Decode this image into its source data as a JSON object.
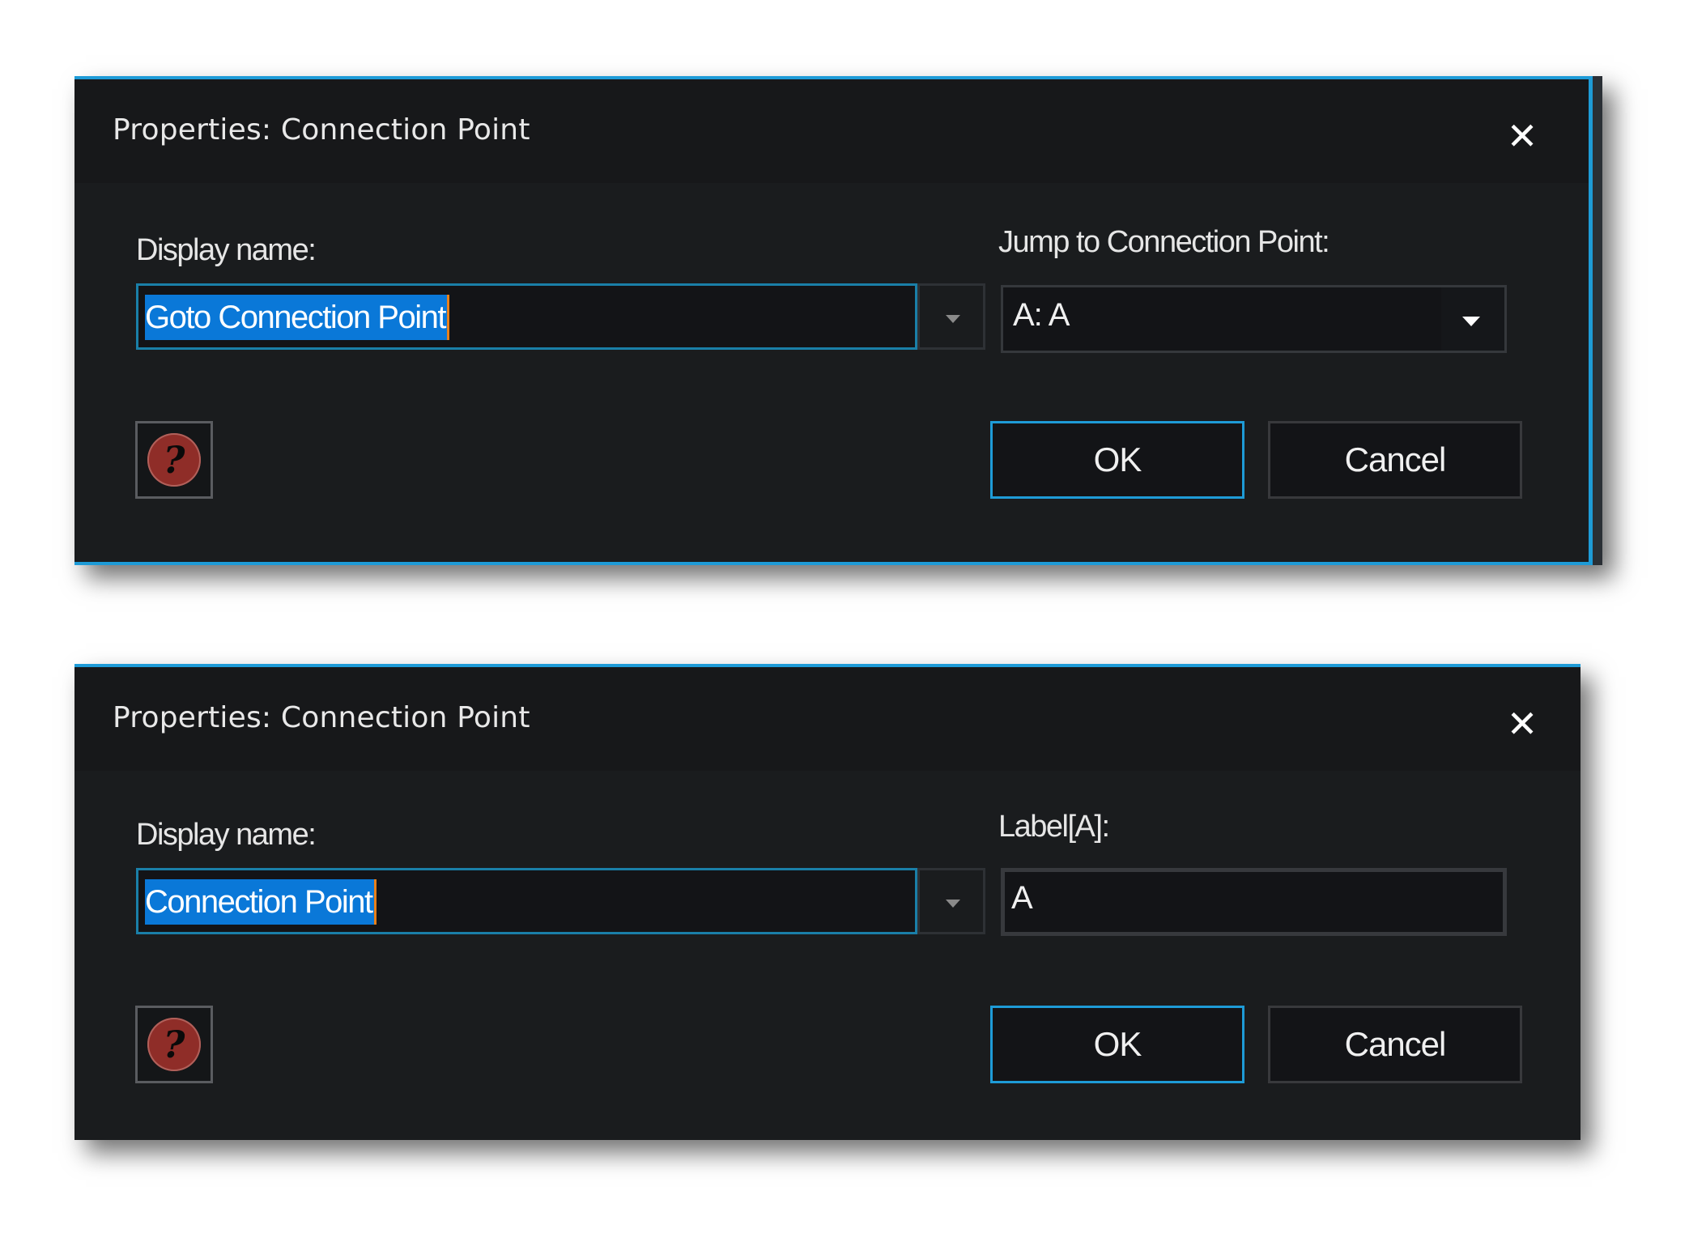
{
  "dialogs": [
    {
      "title": "Properties: Connection Point",
      "close_label": "✕",
      "display_name_label": "Display name:",
      "display_name_value": "Goto Connection Point",
      "right_label": "Jump to Connection Point:",
      "right_field_type": "combo",
      "right_value": "A: A",
      "ok_label": "OK",
      "cancel_label": "Cancel",
      "help_glyph": "?"
    },
    {
      "title": "Properties: Connection Point",
      "close_label": "✕",
      "display_name_label": "Display name:",
      "display_name_value": "Connection Point",
      "right_label": "Label[A]:",
      "right_field_type": "text",
      "right_value": "A",
      "ok_label": "OK",
      "cancel_label": "Cancel",
      "help_glyph": "?"
    }
  ],
  "colors": {
    "accent": "#1e9bd7",
    "selection": "#0a78d8",
    "caret": "#e8801a",
    "dialog_bg": "#1a1c1e",
    "help_icon": "#8f2d28"
  }
}
